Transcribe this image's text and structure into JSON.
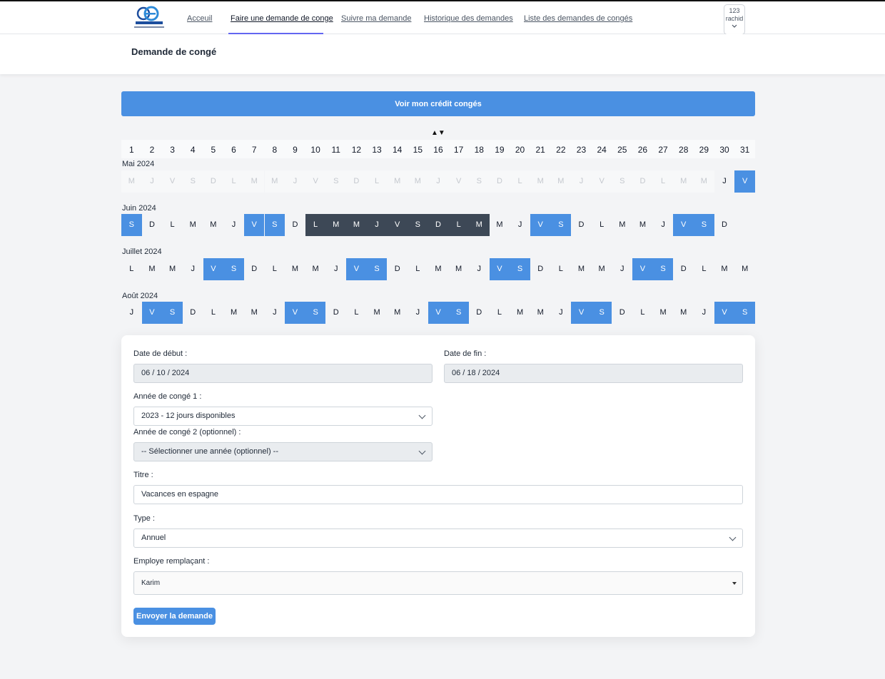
{
  "nav": {
    "links": [
      "Acceuil",
      "Faire une demande de conge",
      "Suivre ma demande",
      "Historique des demandes",
      "Liste des demandes de congés"
    ],
    "active_index": 1,
    "user": {
      "line1": "123",
      "line2": "rachid"
    }
  },
  "header": {
    "title": "Demande de congé"
  },
  "credit_button": "Voir mon crédit congés",
  "sort_icon": "▲▼",
  "calendar": {
    "days": [
      "1",
      "2",
      "3",
      "4",
      "5",
      "6",
      "7",
      "8",
      "9",
      "10",
      "11",
      "12",
      "13",
      "14",
      "15",
      "16",
      "17",
      "18",
      "19",
      "20",
      "21",
      "22",
      "23",
      "24",
      "25",
      "26",
      "27",
      "28",
      "29",
      "30",
      "31"
    ],
    "months": [
      {
        "label": "Mai 2024",
        "letters": [
          "M",
          "J",
          "V",
          "S",
          "D",
          "L",
          "M",
          "M",
          "J",
          "V",
          "S",
          "D",
          "L",
          "M",
          "M",
          "J",
          "V",
          "S",
          "D",
          "L",
          "M",
          "M",
          "J",
          "V",
          "S",
          "D",
          "L",
          "M",
          "M",
          "J",
          "V"
        ],
        "states": [
          "p",
          "p",
          "p",
          "p",
          "p",
          "p",
          "p",
          "p",
          "p",
          "p",
          "p",
          "p",
          "p",
          "p",
          "p",
          "p",
          "p",
          "p",
          "p",
          "p",
          "p",
          "p",
          "p",
          "p",
          "p",
          "p",
          "p",
          "p",
          "p",
          "n",
          "w"
        ]
      },
      {
        "label": "Juin 2024",
        "letters": [
          "S",
          "D",
          "L",
          "M",
          "M",
          "J",
          "V",
          "S",
          "D",
          "L",
          "M",
          "M",
          "J",
          "V",
          "S",
          "D",
          "L",
          "M",
          "M",
          "J",
          "V",
          "S",
          "D",
          "L",
          "M",
          "M",
          "J",
          "V",
          "S",
          "D"
        ],
        "states": [
          "w",
          "n",
          "n",
          "n",
          "n",
          "n",
          "w",
          "w",
          "n",
          "s",
          "s",
          "s",
          "s",
          "s",
          "s",
          "s",
          "s",
          "s",
          "n",
          "n",
          "w",
          "w",
          "n",
          "n",
          "n",
          "n",
          "n",
          "w",
          "w",
          "n"
        ]
      },
      {
        "label": "Juillet 2024",
        "letters": [
          "L",
          "M",
          "M",
          "J",
          "V",
          "S",
          "D",
          "L",
          "M",
          "M",
          "J",
          "V",
          "S",
          "D",
          "L",
          "M",
          "M",
          "J",
          "V",
          "S",
          "D",
          "L",
          "M",
          "M",
          "J",
          "V",
          "S",
          "D",
          "L",
          "M",
          "M"
        ],
        "states": [
          "n",
          "n",
          "n",
          "n",
          "w",
          "w",
          "n",
          "n",
          "n",
          "n",
          "n",
          "w",
          "w",
          "n",
          "n",
          "n",
          "n",
          "n",
          "w",
          "w",
          "n",
          "n",
          "n",
          "n",
          "n",
          "w",
          "w",
          "n",
          "n",
          "n",
          "n"
        ]
      },
      {
        "label": "Août 2024",
        "letters": [
          "J",
          "V",
          "S",
          "D",
          "L",
          "M",
          "M",
          "J",
          "V",
          "S",
          "D",
          "L",
          "M",
          "M",
          "J",
          "V",
          "S",
          "D",
          "L",
          "M",
          "M",
          "J",
          "V",
          "S",
          "D",
          "L",
          "M",
          "M",
          "J",
          "V",
          "S"
        ],
        "states": [
          "n",
          "w",
          "w",
          "n",
          "n",
          "n",
          "n",
          "n",
          "w",
          "w",
          "n",
          "n",
          "n",
          "n",
          "n",
          "w",
          "w",
          "n",
          "n",
          "n",
          "n",
          "n",
          "w",
          "w",
          "n",
          "n",
          "n",
          "n",
          "n",
          "w",
          "w"
        ]
      }
    ]
  },
  "form": {
    "start_label": "Date de début :",
    "start_value": "06 / 10 / 2024",
    "end_label": "Date de fin :",
    "end_value": "06 / 18 / 2024",
    "year1_label": "Année de congé 1 :",
    "year1_value": "2023 - 12 jours disponibles",
    "year2_label": "Année de congé 2 (optionnel) :",
    "year2_value": "-- Sélectionner une année (optionnel) --",
    "title_label": "Titre :",
    "title_value": "Vacances en espagne",
    "type_label": "Type :",
    "type_value": "Annuel",
    "replacement_label": "Employe remplaçant :",
    "replacement_value": "Karim",
    "submit": "Envoyer la demande"
  },
  "colors": {
    "accent": "#4a90e2",
    "selected": "#3d4856",
    "past_text": "#c4c8ce"
  }
}
